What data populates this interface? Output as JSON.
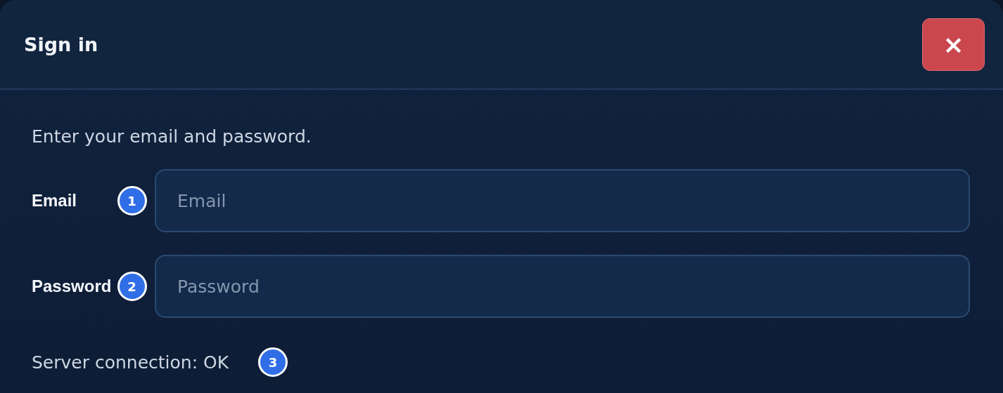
{
  "dialog": {
    "title": "Sign in",
    "close_button": {
      "label": "×"
    }
  },
  "intro": "Enter your email and password.",
  "fields": [
    {
      "label": "Email",
      "placeholder": "Email",
      "badge": "1"
    },
    {
      "label": "Password",
      "placeholder": "Password",
      "badge": "2"
    }
  ],
  "status": {
    "text": "Server connection: OK",
    "badge": "3"
  }
}
